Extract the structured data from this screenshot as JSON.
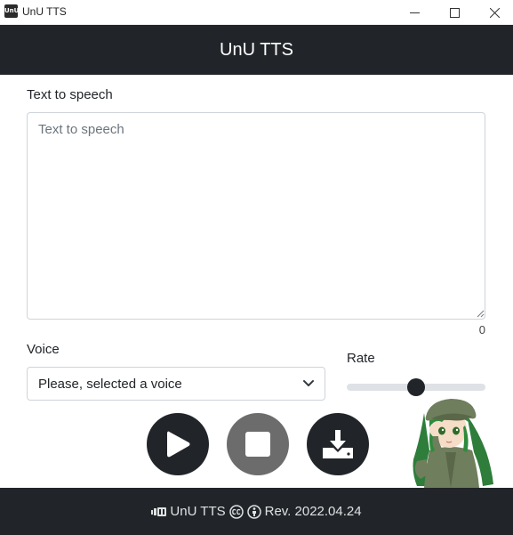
{
  "window": {
    "title": "UnU TTS",
    "app_icon_text": "UnU",
    "controls": [
      "minimize-icon",
      "maximize-icon",
      "close-icon"
    ]
  },
  "header": {
    "title": "UnU TTS"
  },
  "main": {
    "text_label": "Text to speech",
    "textarea_value": "",
    "textarea_placeholder": "Text to speech",
    "char_count": "0",
    "voice_label": "Voice",
    "voice_selected": "Please, selected a voice",
    "rate_label": "Rate",
    "rate_value": 0.5,
    "buttons": {
      "play": "play-icon",
      "stop": "stop-icon",
      "download": "download-icon"
    },
    "mascot": "anime-girl-mascot"
  },
  "footer": {
    "logo": "unu-logo",
    "app_name": "UnU TTS",
    "icons": [
      "cc-icon",
      "attribution-icon"
    ],
    "revision": "Rev. 2022.04.24"
  },
  "colors": {
    "dark": "#212529",
    "stop_button": "#6c6c6c",
    "border": "#ced4da",
    "track": "#dee2e6",
    "footer_text": "#dfe1e3"
  }
}
